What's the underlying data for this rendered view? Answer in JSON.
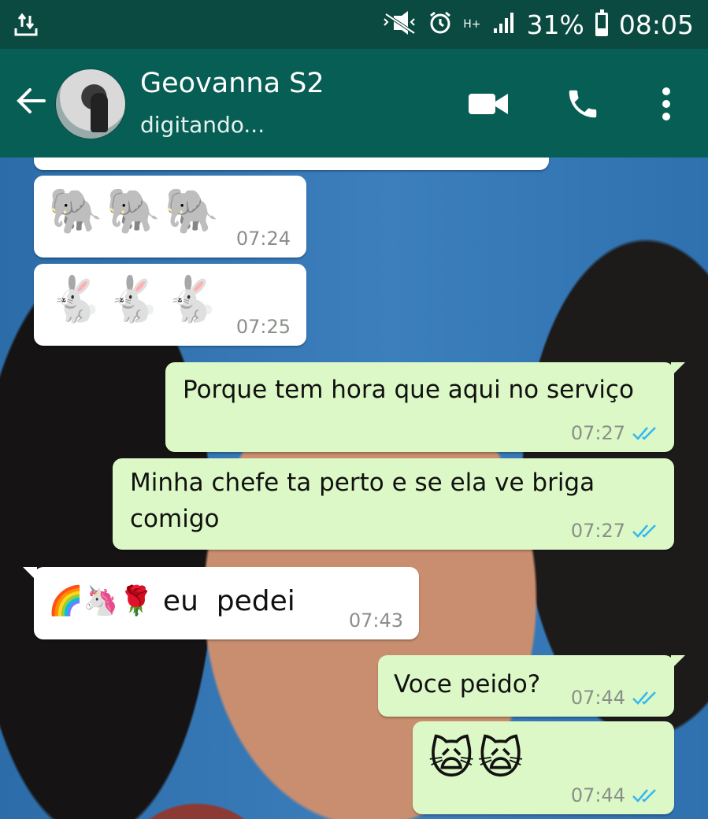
{
  "status_bar": {
    "battery": "31%",
    "time": "08:05",
    "network": "H+"
  },
  "header": {
    "contact_name": "Geovanna S2",
    "status": "digitando..."
  },
  "messages": [
    {
      "dir": "in",
      "content": "🐘🐘🐘",
      "time": "07:24"
    },
    {
      "dir": "in",
      "content": "🐇🐇🐇",
      "time": "07:25"
    },
    {
      "dir": "out",
      "content": "Porque tem hora que aqui no serviço",
      "time": "07:27"
    },
    {
      "dir": "out",
      "content": "Minha chefe ta perto e se ela ve briga comigo",
      "time": "07:27"
    },
    {
      "dir": "in",
      "content": "🌈🦄🌹 eu  pedei",
      "time": "07:43"
    },
    {
      "dir": "out",
      "content": "Voce peido?",
      "time": "07:44"
    },
    {
      "dir": "out",
      "content": "🙀🙀",
      "time": "07:44"
    }
  ],
  "colors": {
    "status_bar": "#0b4a40",
    "header": "#075e54",
    "outgoing_bubble": "#dcf8c6",
    "incoming_bubble": "#ffffff",
    "read_ticks": "#34b7f1"
  },
  "icons": {
    "back": "arrow-left-icon",
    "video": "video-camera-icon",
    "call": "phone-icon",
    "menu": "more-vertical-icon"
  }
}
